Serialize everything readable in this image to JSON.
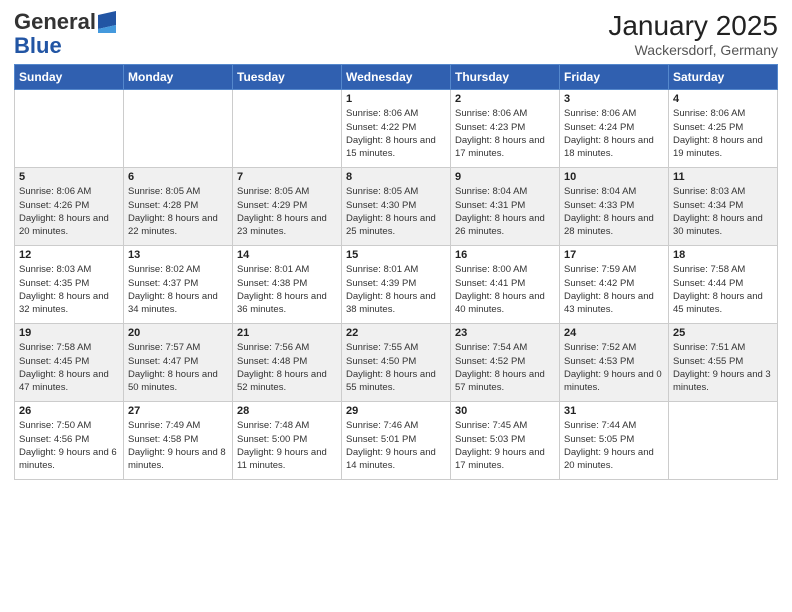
{
  "header": {
    "logo_general": "General",
    "logo_blue": "Blue",
    "month_year": "January 2025",
    "location": "Wackersdorf, Germany"
  },
  "days_of_week": [
    "Sunday",
    "Monday",
    "Tuesday",
    "Wednesday",
    "Thursday",
    "Friday",
    "Saturday"
  ],
  "weeks": [
    [
      {
        "day": "",
        "info": ""
      },
      {
        "day": "",
        "info": ""
      },
      {
        "day": "",
        "info": ""
      },
      {
        "day": "1",
        "info": "Sunrise: 8:06 AM\nSunset: 4:22 PM\nDaylight: 8 hours\nand 15 minutes."
      },
      {
        "day": "2",
        "info": "Sunrise: 8:06 AM\nSunset: 4:23 PM\nDaylight: 8 hours\nand 17 minutes."
      },
      {
        "day": "3",
        "info": "Sunrise: 8:06 AM\nSunset: 4:24 PM\nDaylight: 8 hours\nand 18 minutes."
      },
      {
        "day": "4",
        "info": "Sunrise: 8:06 AM\nSunset: 4:25 PM\nDaylight: 8 hours\nand 19 minutes."
      }
    ],
    [
      {
        "day": "5",
        "info": "Sunrise: 8:06 AM\nSunset: 4:26 PM\nDaylight: 8 hours\nand 20 minutes."
      },
      {
        "day": "6",
        "info": "Sunrise: 8:05 AM\nSunset: 4:28 PM\nDaylight: 8 hours\nand 22 minutes."
      },
      {
        "day": "7",
        "info": "Sunrise: 8:05 AM\nSunset: 4:29 PM\nDaylight: 8 hours\nand 23 minutes."
      },
      {
        "day": "8",
        "info": "Sunrise: 8:05 AM\nSunset: 4:30 PM\nDaylight: 8 hours\nand 25 minutes."
      },
      {
        "day": "9",
        "info": "Sunrise: 8:04 AM\nSunset: 4:31 PM\nDaylight: 8 hours\nand 26 minutes."
      },
      {
        "day": "10",
        "info": "Sunrise: 8:04 AM\nSunset: 4:33 PM\nDaylight: 8 hours\nand 28 minutes."
      },
      {
        "day": "11",
        "info": "Sunrise: 8:03 AM\nSunset: 4:34 PM\nDaylight: 8 hours\nand 30 minutes."
      }
    ],
    [
      {
        "day": "12",
        "info": "Sunrise: 8:03 AM\nSunset: 4:35 PM\nDaylight: 8 hours\nand 32 minutes."
      },
      {
        "day": "13",
        "info": "Sunrise: 8:02 AM\nSunset: 4:37 PM\nDaylight: 8 hours\nand 34 minutes."
      },
      {
        "day": "14",
        "info": "Sunrise: 8:01 AM\nSunset: 4:38 PM\nDaylight: 8 hours\nand 36 minutes."
      },
      {
        "day": "15",
        "info": "Sunrise: 8:01 AM\nSunset: 4:39 PM\nDaylight: 8 hours\nand 38 minutes."
      },
      {
        "day": "16",
        "info": "Sunrise: 8:00 AM\nSunset: 4:41 PM\nDaylight: 8 hours\nand 40 minutes."
      },
      {
        "day": "17",
        "info": "Sunrise: 7:59 AM\nSunset: 4:42 PM\nDaylight: 8 hours\nand 43 minutes."
      },
      {
        "day": "18",
        "info": "Sunrise: 7:58 AM\nSunset: 4:44 PM\nDaylight: 8 hours\nand 45 minutes."
      }
    ],
    [
      {
        "day": "19",
        "info": "Sunrise: 7:58 AM\nSunset: 4:45 PM\nDaylight: 8 hours\nand 47 minutes."
      },
      {
        "day": "20",
        "info": "Sunrise: 7:57 AM\nSunset: 4:47 PM\nDaylight: 8 hours\nand 50 minutes."
      },
      {
        "day": "21",
        "info": "Sunrise: 7:56 AM\nSunset: 4:48 PM\nDaylight: 8 hours\nand 52 minutes."
      },
      {
        "day": "22",
        "info": "Sunrise: 7:55 AM\nSunset: 4:50 PM\nDaylight: 8 hours\nand 55 minutes."
      },
      {
        "day": "23",
        "info": "Sunrise: 7:54 AM\nSunset: 4:52 PM\nDaylight: 8 hours\nand 57 minutes."
      },
      {
        "day": "24",
        "info": "Sunrise: 7:52 AM\nSunset: 4:53 PM\nDaylight: 9 hours\nand 0 minutes."
      },
      {
        "day": "25",
        "info": "Sunrise: 7:51 AM\nSunset: 4:55 PM\nDaylight: 9 hours\nand 3 minutes."
      }
    ],
    [
      {
        "day": "26",
        "info": "Sunrise: 7:50 AM\nSunset: 4:56 PM\nDaylight: 9 hours\nand 6 minutes."
      },
      {
        "day": "27",
        "info": "Sunrise: 7:49 AM\nSunset: 4:58 PM\nDaylight: 9 hours\nand 8 minutes."
      },
      {
        "day": "28",
        "info": "Sunrise: 7:48 AM\nSunset: 5:00 PM\nDaylight: 9 hours\nand 11 minutes."
      },
      {
        "day": "29",
        "info": "Sunrise: 7:46 AM\nSunset: 5:01 PM\nDaylight: 9 hours\nand 14 minutes."
      },
      {
        "day": "30",
        "info": "Sunrise: 7:45 AM\nSunset: 5:03 PM\nDaylight: 9 hours\nand 17 minutes."
      },
      {
        "day": "31",
        "info": "Sunrise: 7:44 AM\nSunset: 5:05 PM\nDaylight: 9 hours\nand 20 minutes."
      },
      {
        "day": "",
        "info": ""
      }
    ]
  ]
}
